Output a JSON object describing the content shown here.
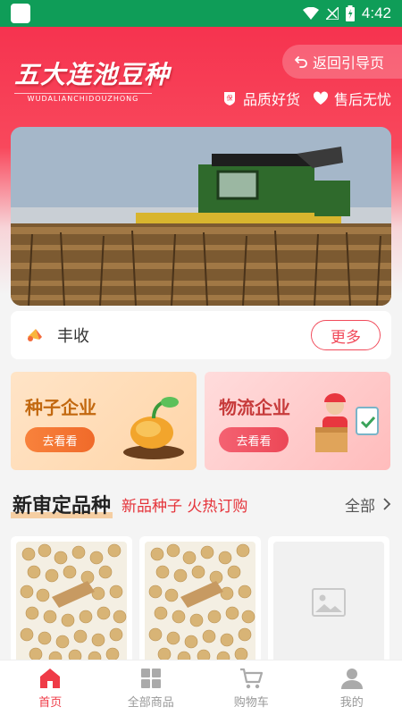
{
  "status_bar": {
    "time": "4:42"
  },
  "header": {
    "brand_title": "五大连池豆种",
    "brand_subtitle": "WUDALIANCHIDOUZHONG",
    "back_label": "返回引导页",
    "features": [
      {
        "label": "品质好货",
        "icon": "quality-badge-icon"
      },
      {
        "label": "售后无忧",
        "icon": "heart-icon"
      }
    ]
  },
  "harvest": {
    "label": "丰收",
    "more_label": "更多",
    "icon": "megaphone-icon"
  },
  "cards": [
    {
      "title": "种子企业",
      "button": "去看看",
      "accent": "#c2680f"
    },
    {
      "title": "物流企业",
      "button": "去看看",
      "accent": "#c73a3a"
    }
  ],
  "section": {
    "title": "新审定品种",
    "subtitle": "新品种子 火热订购",
    "all_label": "全部"
  },
  "products": [
    {
      "image": "soybeans-photo"
    },
    {
      "image": "soybeans-photo"
    },
    {
      "image": "image-placeholder-icon"
    }
  ],
  "nav": [
    {
      "label": "首页",
      "icon": "home-icon",
      "active": true
    },
    {
      "label": "全部商品",
      "icon": "grid-icon",
      "active": false
    },
    {
      "label": "购物车",
      "icon": "cart-icon",
      "active": false
    },
    {
      "label": "我的",
      "icon": "user-icon",
      "active": false
    }
  ],
  "colors": {
    "primary": "#f6334f",
    "status_bar": "#0f9d58",
    "active_nav": "#ef3b47"
  }
}
